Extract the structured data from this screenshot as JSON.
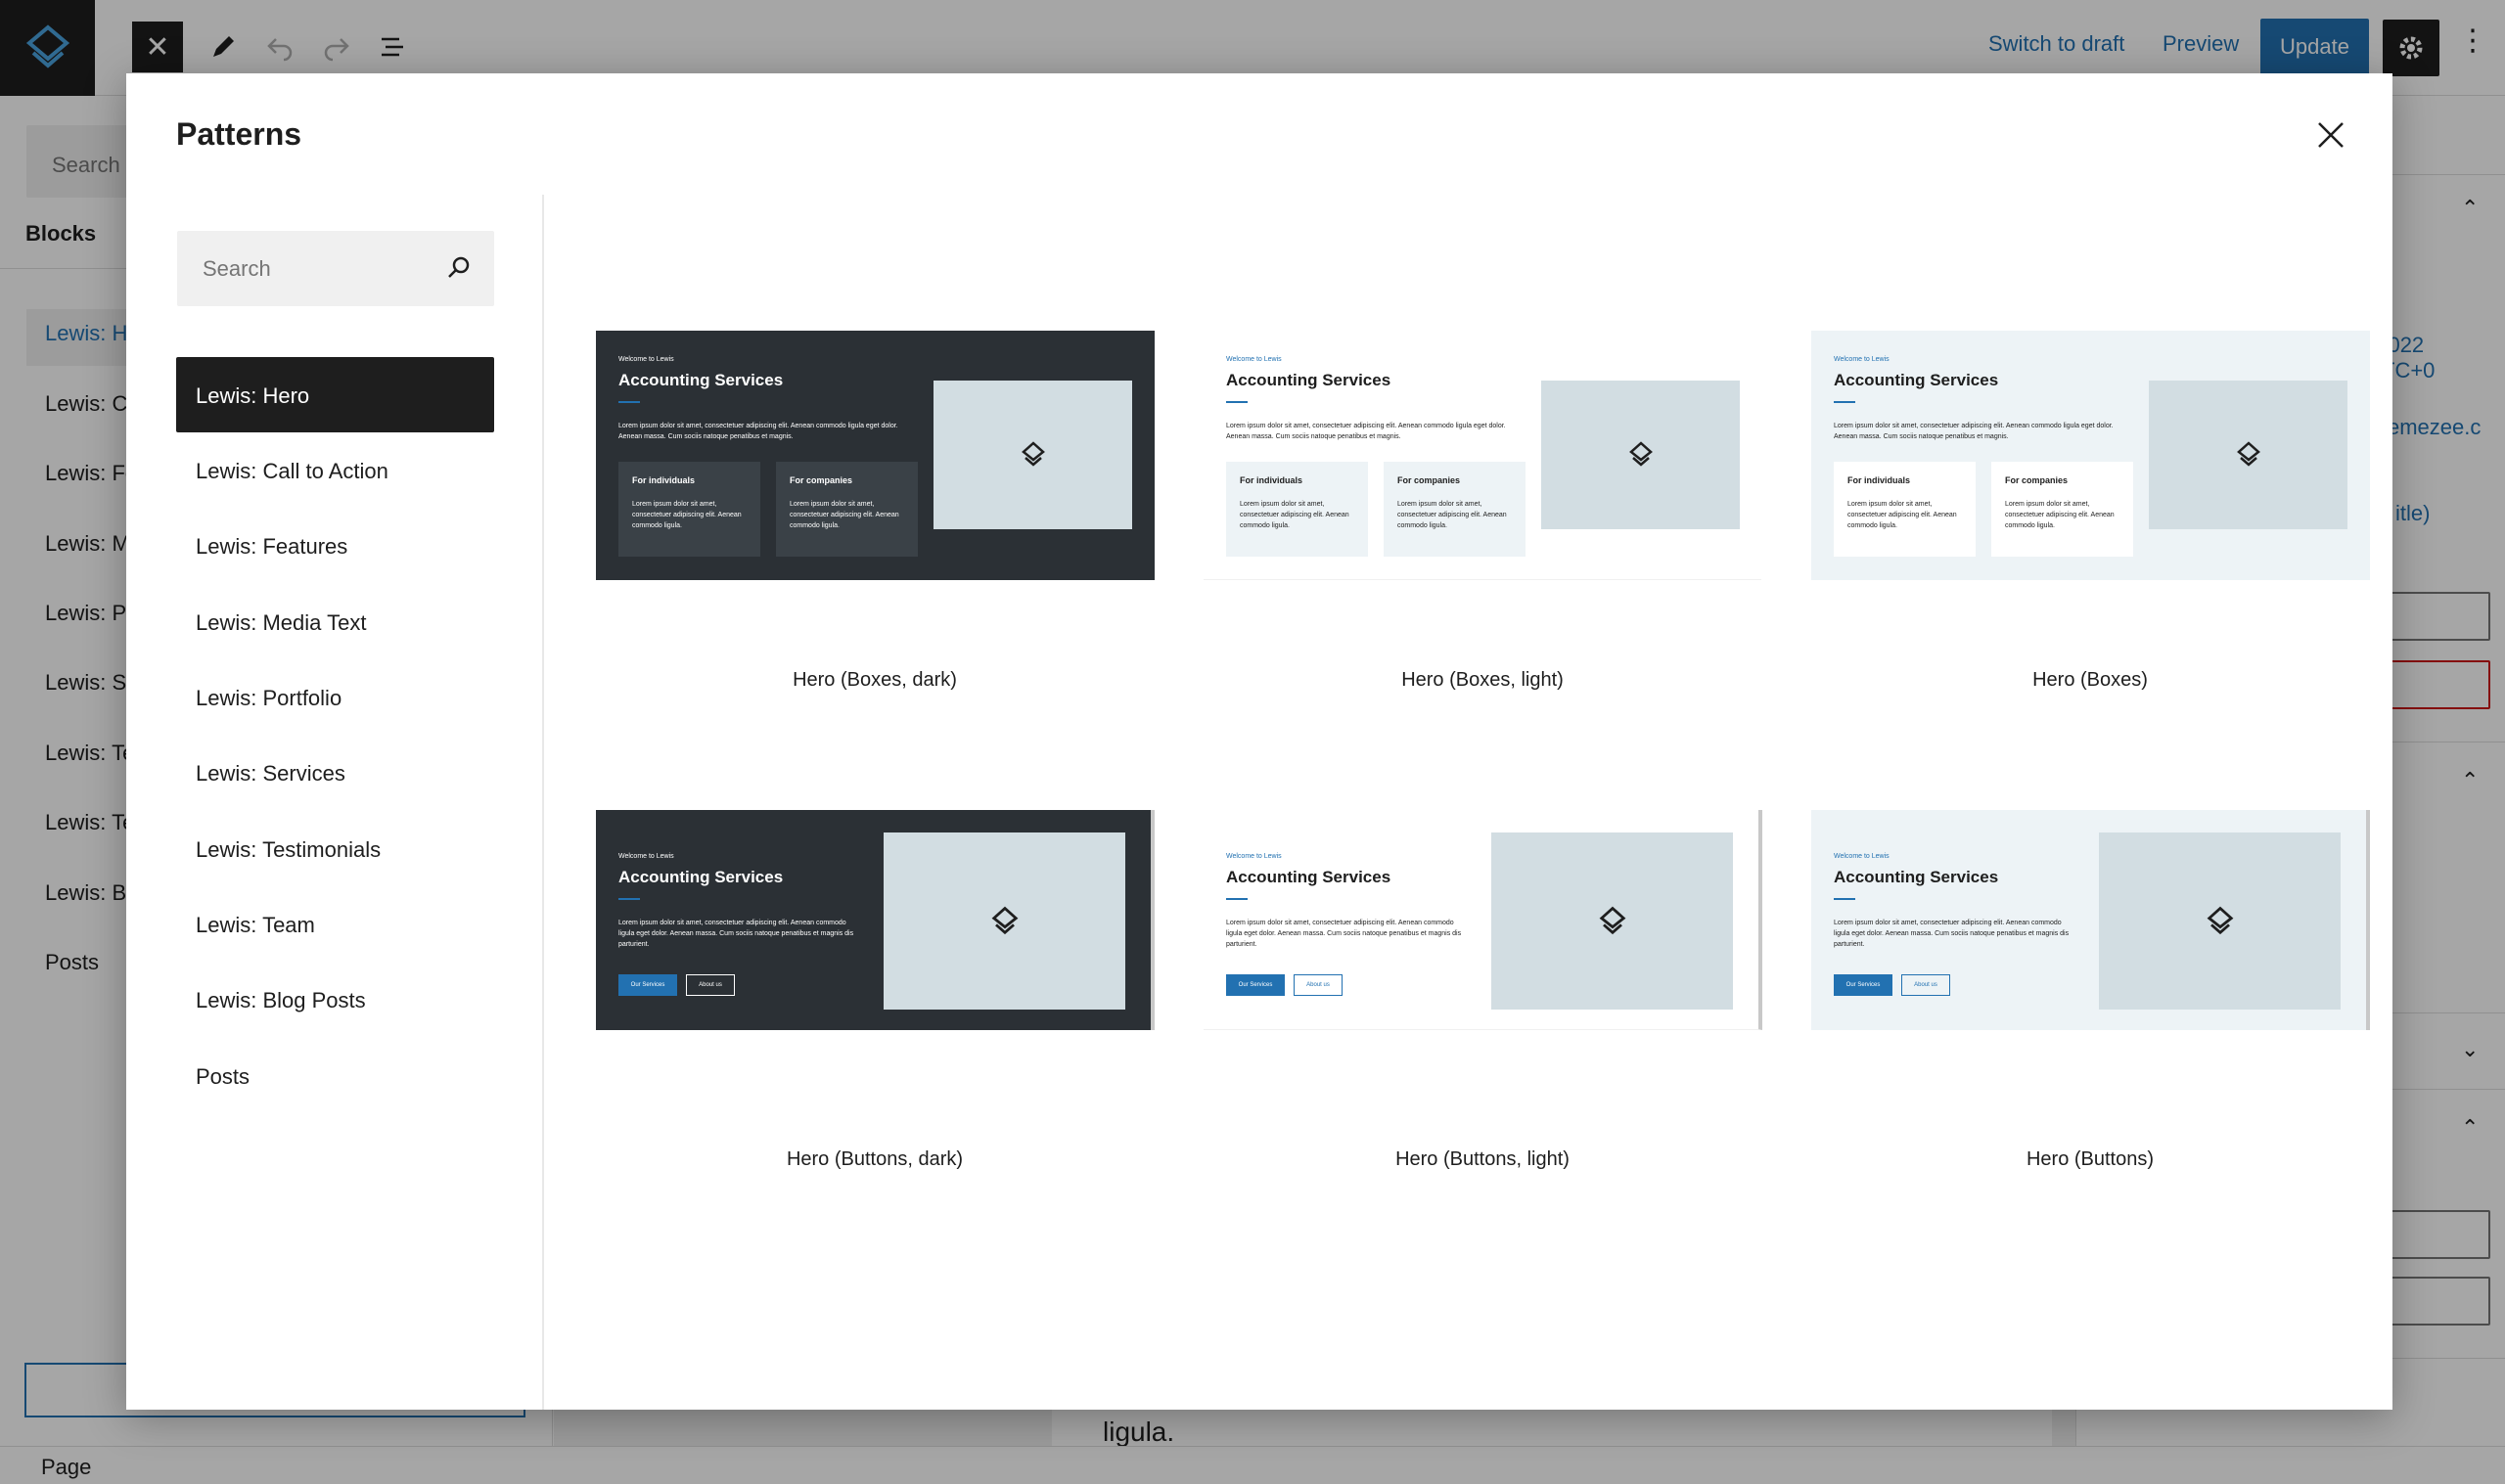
{
  "editor": {
    "close_glyph": "✕",
    "switch_to_draft": "Switch to draft",
    "preview": "Preview",
    "update": "Update",
    "more_glyph": "⋮",
    "status": "Page",
    "canvas_text": "ligula."
  },
  "left_panel": {
    "search_placeholder": "Search",
    "tab": "Blocks",
    "items": [
      "Lewis: H",
      "Lewis: C",
      "Lewis: Fe",
      "Lewis: M",
      "Lewis: P",
      "Lewis: S",
      "Lewis: Te",
      "Lewis: Te",
      "Lewis: B",
      "Posts"
    ]
  },
  "right_panel": {
    "date_fragment": ", 2022",
    "tz_fragment": "TC+0",
    "url_fragment": "emezee.c",
    "title_fragment": "itle)"
  },
  "modal": {
    "title": "Patterns",
    "search_placeholder": "Search",
    "categories": [
      "Lewis: Hero",
      "Lewis: Call to Action",
      "Lewis: Features",
      "Lewis: Media Text",
      "Lewis: Portfolio",
      "Lewis: Services",
      "Lewis: Testimonials",
      "Lewis: Team",
      "Lewis: Blog Posts",
      "Posts"
    ],
    "active_category": "Lewis: Hero",
    "patterns": [
      "Hero (Boxes, dark)",
      "Hero (Boxes, light)",
      "Hero (Boxes)",
      "Hero (Buttons, dark)",
      "Hero (Buttons, light)",
      "Hero (Buttons)"
    ]
  },
  "preview": {
    "eyebrow": "Welcome to Lewis",
    "heading": "Accounting Services",
    "body_boxes": "Lorem ipsum dolor sit amet, consectetuer adipiscing elit. Aenean commodo ligula eget dolor. Aenean massa. Cum sociis natoque penatibus et magnis.",
    "body_buttons": "Lorem ipsum dolor sit amet, consectetuer adipiscing elit. Aenean commodo ligula eget dolor. Aenean massa. Cum sociis natoque penatibus et magnis dis parturient.",
    "box1_title": "For individuals",
    "box2_title": "For companies",
    "box_body": "Lorem ipsum dolor sit amet, consectetuer adipiscing elit. Aenean commodo ligula.",
    "btn_primary": "Our Services",
    "btn_secondary": "About us"
  },
  "colors": {
    "accent": "#2271b1",
    "dark": "#2b3035",
    "dark_box": "#3a4147",
    "light_bg": "#edf3f6",
    "image_placeholder": "#d2dde2"
  }
}
